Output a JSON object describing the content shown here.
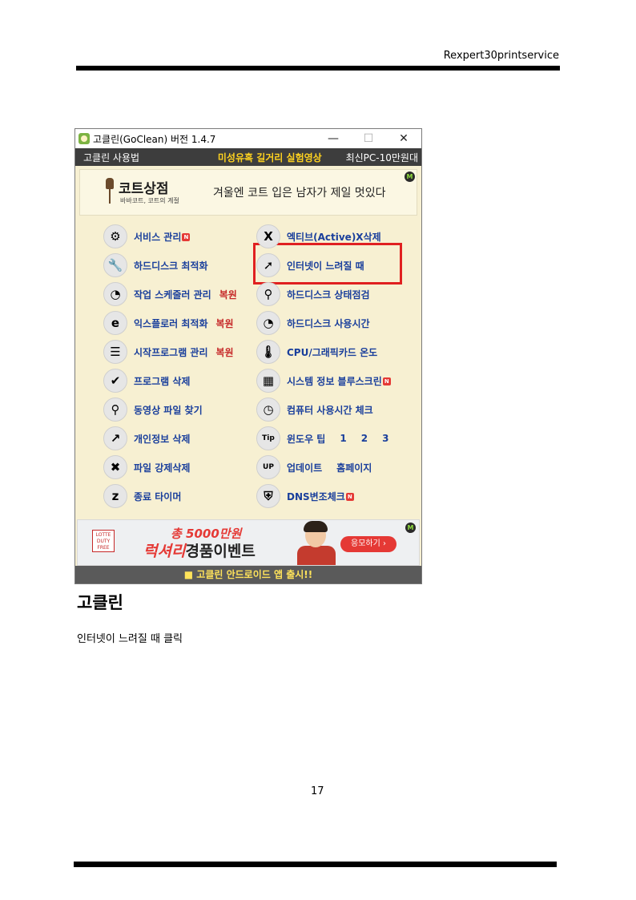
{
  "page": {
    "header_text": "Rexpert30printservice",
    "heading": "고클린",
    "body_text": "인터넷이 느려질 때 클릭",
    "page_number": "17"
  },
  "window": {
    "title": "고클린(GoClean) 버전 1.4.7",
    "minimize": "—",
    "maximize": "☐",
    "close": "✕"
  },
  "menubar": {
    "left": "고클린 사용법",
    "center": "미성유혹 길거리 실험영상",
    "right": "최신PC-10만원대"
  },
  "top_banner": {
    "shop_name": "코트상점",
    "shop_sub": "바바코트, 코트의 계절",
    "slogan": "겨울엔 코트 입은 남자가 제일 멋있다",
    "badge": "M"
  },
  "left_items": [
    {
      "label": "서비스 관리",
      "icon": "⚙",
      "badge": "N",
      "restore": ""
    },
    {
      "label": "하드디스크 최적화",
      "icon": "🔧",
      "badge": "",
      "restore": ""
    },
    {
      "label": "작업 스케줄러 관리",
      "icon": "◔",
      "badge": "",
      "restore": "복원"
    },
    {
      "label": "익스플로러 최적화",
      "icon": "e",
      "badge": "",
      "restore": "복원"
    },
    {
      "label": "시작프로그램 관리",
      "icon": "☰",
      "badge": "",
      "restore": "복원"
    },
    {
      "label": "프로그램 삭제",
      "icon": "✔",
      "badge": "",
      "restore": ""
    },
    {
      "label": "동영상 파일 찾기",
      "icon": "⚲",
      "badge": "",
      "restore": ""
    },
    {
      "label": "개인정보 삭제",
      "icon": "↗",
      "badge": "",
      "restore": ""
    },
    {
      "label": "파일 강제삭제",
      "icon": "✖",
      "badge": "",
      "restore": ""
    },
    {
      "label": "종료 타이머",
      "icon": "z",
      "badge": "",
      "restore": ""
    }
  ],
  "right_items": [
    {
      "label": "엑티브(Active)X삭제",
      "icon": "X",
      "badge": ""
    },
    {
      "label": "인터넷이 느려질 때",
      "icon": "➚",
      "badge": ""
    },
    {
      "label": "하드디스크 상태점검",
      "icon": "⚲",
      "badge": ""
    },
    {
      "label": "하드디스크 사용시간",
      "icon": "◔",
      "badge": ""
    },
    {
      "label": "CPU/그래픽카드 온도",
      "icon": "🌡",
      "badge": ""
    },
    {
      "label": "시스템 정보 블루스크린",
      "icon": "▦",
      "badge": "N"
    },
    {
      "label": "컴퓨터 사용시간 체크",
      "icon": "◷",
      "badge": ""
    },
    {
      "label": "윈도우 팁",
      "icon": "Tip",
      "badge": "",
      "extra": [
        "1",
        "2",
        "3"
      ]
    },
    {
      "label": "업데이트",
      "icon": "UP",
      "badge": "",
      "extra": [
        "홈페이지"
      ]
    },
    {
      "label": "DNS변조체크",
      "icon": "⛨",
      "badge": "N"
    }
  ],
  "ad": {
    "lotte": "LOTTE DUTY FREE",
    "line1": "총 5000만원",
    "line2_accent": "럭셔리",
    "line2_rest": "경품이벤트",
    "button": "응모하기 ›",
    "badge": "M"
  },
  "footer": "■ 고클린 안드로이드 앱 출시!!",
  "colors": {
    "menubar": "#3d3d3d",
    "menu_highlight": "#ffd21f",
    "item_label": "#1a3f9c",
    "restore_label": "#c62828",
    "highlight_box": "#e02020"
  }
}
